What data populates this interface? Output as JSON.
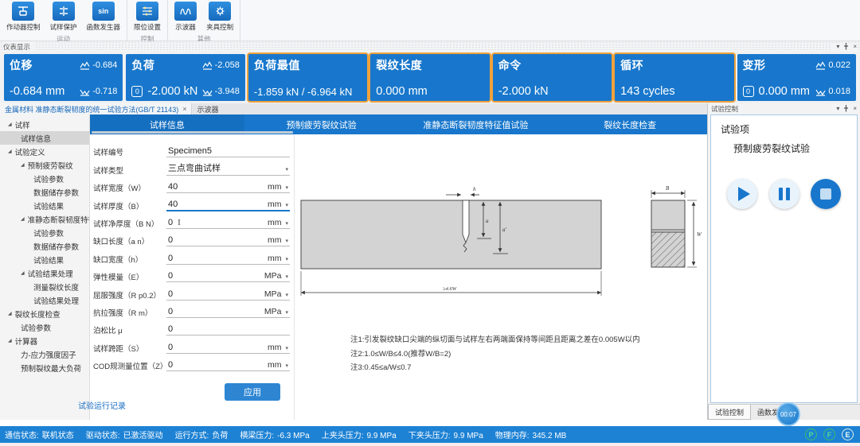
{
  "chrome": {
    "collapse": "▾",
    "close": "×",
    "expander": "◢",
    "caret": "▾",
    "cursor": "I"
  },
  "ribbon": {
    "groups": [
      {
        "label": "运动",
        "tools": [
          {
            "label": "作动器控制"
          },
          {
            "label": "试样保护"
          },
          {
            "label": "函数发生器",
            "icon_text": "sin"
          }
        ]
      },
      {
        "label": "控制",
        "tools": [
          {
            "label": "限位设置"
          }
        ]
      },
      {
        "label": "其他",
        "tools": [
          {
            "label": "示波器"
          },
          {
            "label": "夹具控制"
          }
        ]
      }
    ]
  },
  "instrument": {
    "title": "仪表显示",
    "gauges": [
      {
        "name": "位移",
        "top_right": "-0.684",
        "value": "-0.684 mm",
        "bottom_right": "-0.718"
      },
      {
        "name": "负荷",
        "top_right": "-2.058",
        "zero": "0",
        "value": "-2.000 kN",
        "bottom_right": "-3.948"
      },
      {
        "name": "负荷最值",
        "value": "-1.859 kN / -6.964 kN"
      },
      {
        "name": "裂纹长度",
        "value": "0.000 mm"
      },
      {
        "name": "命令",
        "value": "-2.000 kN"
      },
      {
        "name": "循环",
        "value": "143 cycles"
      },
      {
        "name": "变形",
        "top_right": "0.022",
        "zero": "0",
        "value": "0.000 mm",
        "bottom_right": "0.018"
      }
    ]
  },
  "doc_tabs": [
    {
      "label": "金属材料 准静态断裂韧度的统一试验方法(GB/T 21143)",
      "close": "×"
    },
    {
      "label": "示波器"
    }
  ],
  "form_tabs": [
    "试样信息",
    "预制疲劳裂纹试验",
    "准静态断裂韧度特征值试验",
    "裂纹长度检查"
  ],
  "tree": {
    "items": [
      {
        "label": "试样"
      },
      {
        "label": "试样信息"
      },
      {
        "label": "试验定义"
      },
      {
        "label": "预制疲劳裂纹"
      },
      {
        "label": "试验参数"
      },
      {
        "label": "数据储存参数"
      },
      {
        "label": "试验结果"
      },
      {
        "label": "准静态断裂韧度特征值"
      },
      {
        "label": "试验参数"
      },
      {
        "label": "数据储存参数"
      },
      {
        "label": "试验结果"
      },
      {
        "label": "试验结果处理"
      },
      {
        "label": "测量裂纹长度"
      },
      {
        "label": "试验结果处理"
      },
      {
        "label": "裂纹长度检查"
      },
      {
        "label": "试验参数"
      },
      {
        "label": "计算器"
      },
      {
        "label": "力-应力强度因子"
      },
      {
        "label": "预制裂纹最大负荷"
      }
    ],
    "footer_link": "试验运行记录"
  },
  "form": {
    "rows": [
      {
        "label": "试样编号",
        "value": "Specimen5",
        "unit": ""
      },
      {
        "label": "试样类型",
        "value": "三点弯曲试样",
        "unit": ""
      },
      {
        "label": "试样宽度（W）",
        "value": "40",
        "unit": "mm"
      },
      {
        "label": "试样厚度（B）",
        "value": "40",
        "unit": "mm"
      },
      {
        "label": "试样净厚度（B N）",
        "value": "0",
        "unit": "mm"
      },
      {
        "label": "缺口长度（a n）",
        "value": "0",
        "unit": "mm"
      },
      {
        "label": "缺口宽度（h）",
        "value": "0",
        "unit": "mm"
      },
      {
        "label": "弹性模量（E）",
        "value": "0",
        "unit": "MPa"
      },
      {
        "label": "屈服强度（R p0.2）",
        "value": "0",
        "unit": "MPa"
      },
      {
        "label": "抗拉强度（R m）",
        "value": "0",
        "unit": "MPa"
      },
      {
        "label": "泊松比 μ",
        "value": "0",
        "unit": ""
      },
      {
        "label": "试样跨距（S）",
        "value": "0",
        "unit": "mm"
      },
      {
        "label": "COD规测量位置（Z）",
        "value": "0",
        "unit": "mm"
      }
    ],
    "apply_label": "应用"
  },
  "diagram": {
    "labels": {
      "notch_width": "h",
      "notch_depth": "a",
      "crack_depth": "a'",
      "length": "≥4.6W",
      "section_width": "B",
      "section_height": "W"
    },
    "notes": [
      "注1:引发裂纹缺口尖端的纵切面与试样左右两端面保持等间距且距离之差在0.005W以内",
      "注2:1.0≤W/B≤4.0(推荐W/B=2)",
      "注3:0.45≤a/W≤0.7"
    ]
  },
  "control_panel": {
    "title": "试验控制",
    "item_label": "试验项",
    "item_value": "预制疲劳裂纹试验",
    "bottom_tabs": [
      "试验控制",
      "函数发生器"
    ],
    "timer": "00:07"
  },
  "status": {
    "items": [
      {
        "k": "通信状态:",
        "v": "联机状态"
      },
      {
        "k": "驱动状态:",
        "v": "已激活驱动"
      },
      {
        "k": "运行方式:",
        "v": "负荷"
      },
      {
        "k": "横梁压力:",
        "v": "-6.3  MPa"
      },
      {
        "k": "上夹头压力:",
        "v": "9.9  MPa"
      },
      {
        "k": "下夹头压力:",
        "v": "9.9  MPa"
      },
      {
        "k": "物理内存:",
        "v": "345.2  MB"
      }
    ],
    "indicators": [
      "P",
      "F",
      "E"
    ]
  },
  "colors": {
    "accent_blue": "#1877cc",
    "highlight_orange": "#f0a23c",
    "status_blue": "#1e82d4",
    "apply_blue": "#2e86d3"
  }
}
